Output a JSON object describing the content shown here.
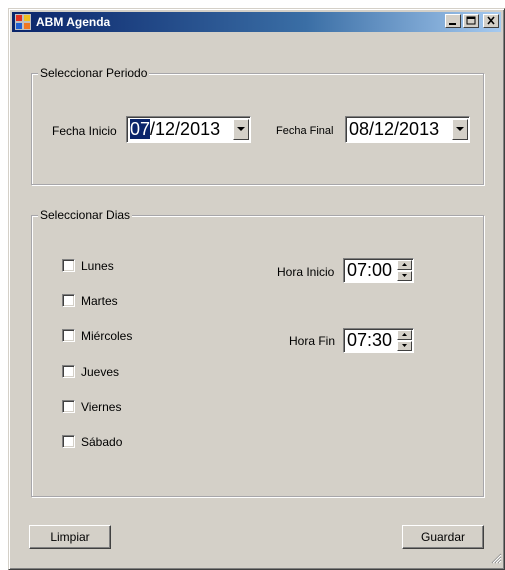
{
  "window": {
    "title": "ABM Agenda",
    "icon": "app-icon",
    "controls": [
      "minimize-icon",
      "maximize-icon",
      "close-icon"
    ]
  },
  "periodo": {
    "legend": "Seleccionar Periodo",
    "fecha_inicio": {
      "label": "Fecha Inicio",
      "value_selected": "07",
      "value_rest": "/12/2013"
    },
    "fecha_final": {
      "label": "Fecha Final",
      "value": "08/12/2013"
    }
  },
  "dias": {
    "legend": "Seleccionar Dias",
    "items": [
      {
        "label": "Lunes",
        "checked": false
      },
      {
        "label": "Martes",
        "checked": false
      },
      {
        "label": "Miércoles",
        "checked": false
      },
      {
        "label": "Jueves",
        "checked": false
      },
      {
        "label": "Viernes",
        "checked": false
      },
      {
        "label": "Sábado",
        "checked": false
      }
    ],
    "hora_inicio": {
      "label": "Hora Inicio",
      "value": "07:00"
    },
    "hora_fin": {
      "label": "Hora Fin",
      "value": "07:30"
    }
  },
  "buttons": {
    "limpiar": "Limpiar",
    "guardar": "Guardar"
  },
  "colors": {
    "face": "#d4d0c8",
    "title_start": "#0a246a",
    "title_end": "#a6caf0",
    "selection": "#0a246a"
  }
}
